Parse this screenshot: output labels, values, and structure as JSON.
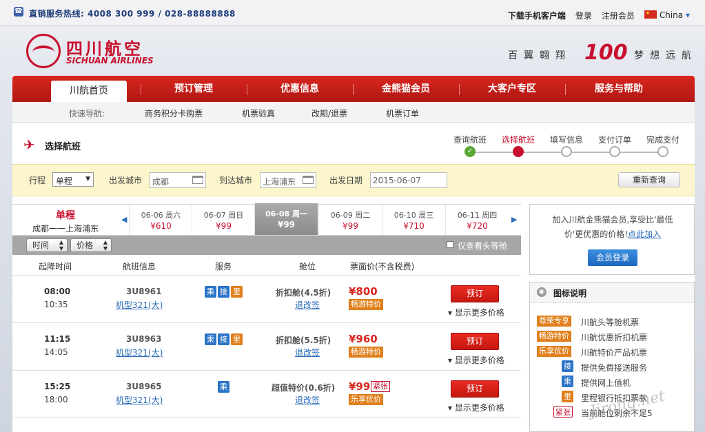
{
  "topbar": {
    "hotline": "直销服务热线: 4008  300  999  /  028-88888888",
    "links": [
      "下载手机客户端",
      "登录",
      "注册会员"
    ],
    "locale": "China",
    "locale_caret": "▾"
  },
  "header": {
    "logo_cn": "四川航空",
    "logo_en": "SICHUAN AIRLINES",
    "slogan_left": "百翼翱翔",
    "slogan_mark": "100",
    "slogan_right": "梦想远航"
  },
  "nav": {
    "items": [
      "川航首页",
      "预订管理",
      "优惠信息",
      "金熊猫会员",
      "大客户专区",
      "服务与帮助"
    ],
    "active_index": 0
  },
  "subnav": {
    "label": "快速导航:",
    "items": [
      "商务积分卡购票",
      "机票验真",
      "改期/退票",
      "机票订单"
    ]
  },
  "steps": {
    "title": "选择航班",
    "items": [
      "查询航班",
      "选择航班",
      "填写信息",
      "支付订单",
      "完成支付"
    ],
    "current_index": 1,
    "done_mark": "✓"
  },
  "search": {
    "trip_label": "行程",
    "trip_value": "单程",
    "dep_label": "出发城市",
    "dep_value": "成都",
    "arr_label": "到达城市",
    "arr_value": "上海浦东",
    "date_label": "出发日期",
    "date_value": "2015-06-07",
    "research_label": "重新查询"
  },
  "dates": {
    "trip_type": "单程",
    "route": "成都一一上海浦东",
    "prev_icon": "◀",
    "next_icon": "▶",
    "cells": [
      {
        "date": "06-06 周六",
        "price": "¥610"
      },
      {
        "date": "06-07 周日",
        "price": "¥99"
      },
      {
        "date": "06-08 周一",
        "price": "¥99"
      },
      {
        "date": "06-09 周二",
        "price": "¥99"
      },
      {
        "date": "06-10 周三",
        "price": "¥710"
      },
      {
        "date": "06-11 周四",
        "price": "¥720"
      }
    ],
    "selected_index": 2
  },
  "sortbar": {
    "time_label": "时间",
    "price_label": "价格",
    "first_only_label": "仅查看头等舱"
  },
  "columns": [
    "起降时间",
    "航班信息",
    "服务",
    "舱位",
    "票面价(不含税费)"
  ],
  "flights": [
    {
      "dep": "08:00",
      "arr": "10:35",
      "no": "3U8961",
      "plane": "机型321(大)",
      "services": [
        "乘",
        "接",
        "里"
      ],
      "cabin": "折扣舱(4.5折)",
      "rule": "退改签",
      "price": "¥800",
      "tag": "畅游特价",
      "urgent": "",
      "book": "预订",
      "more": "显示更多价格"
    },
    {
      "dep": "11:15",
      "arr": "14:05",
      "no": "3U8963",
      "plane": "机型321(大)",
      "services": [
        "乘",
        "接",
        "里"
      ],
      "cabin": "折扣舱(5.5折)",
      "rule": "退改签",
      "price": "¥960",
      "tag": "畅游特价",
      "urgent": "",
      "book": "预订",
      "more": "显示更多价格"
    },
    {
      "dep": "15:25",
      "arr": "18:00",
      "no": "3U8965",
      "plane": "机型321(大)",
      "services": [
        "乘"
      ],
      "cabin": "超值特价(0.6折)",
      "rule": "退改签",
      "price": "¥99",
      "tag": "乐享优价",
      "urgent": "紧张",
      "book": "预订",
      "more": "显示更多价格"
    }
  ],
  "member_box": {
    "line1": "加入川航金熊猫会员,享受比'最低",
    "line2_prefix": "价'更优惠的价格!",
    "link": "点此加入",
    "login": "会员登录"
  },
  "legend": {
    "title": "图标说明",
    "badges": [
      {
        "badge": "尊荣专享",
        "text": "川航头等舱机票"
      },
      {
        "badge": "畅游特价",
        "text": "川航优惠折扣机票"
      },
      {
        "badge": "乐享优价",
        "text": "川航特价产品机票"
      }
    ],
    "icons": [
      {
        "icon": "接",
        "text": "提供免费接送服务",
        "color": "#2a73c6"
      },
      {
        "icon": "乘",
        "text": "提供网上值机",
        "color": "#2a73c6"
      },
      {
        "icon": "里",
        "text": "里程银行抵扣票款",
        "color": "#e07f1b"
      },
      {
        "icon": "紧张",
        "text": "当前舱位剩余不足5",
        "color": "#c8102e"
      }
    ]
  },
  "watermark": "Jirong.net",
  "colors": {
    "brand_red": "#c8102e",
    "nav_red": "#d8261e",
    "link_blue": "#2a6cb8",
    "tag_orange": "#e07f1b"
  }
}
